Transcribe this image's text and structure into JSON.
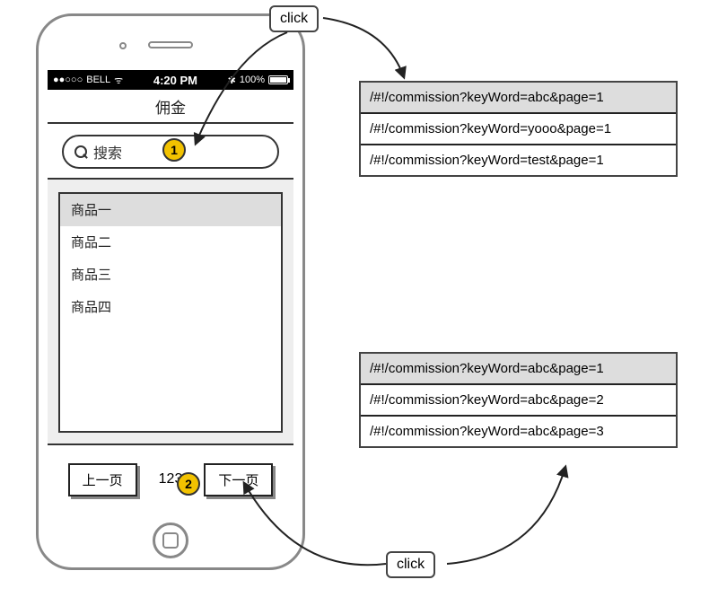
{
  "statusbar": {
    "carrier": "BELL",
    "signal": "●●○○○",
    "wifi": "ᯤ",
    "time": "4:20 PM",
    "bt": "✱",
    "battery_pct": "100%"
  },
  "header": {
    "title": "佣金"
  },
  "search": {
    "placeholder": "搜索"
  },
  "list": {
    "items": [
      "商品一",
      "商品二",
      "商品三",
      "商品四"
    ]
  },
  "pager": {
    "prev": "上一页",
    "nums": "123",
    "next": "下一页"
  },
  "callouts": {
    "top": {
      "label": "click",
      "rows": [
        "/#!/commission?keyWord=abc&page=1",
        "/#!/commission?keyWord=yooo&page=1",
        "/#!/commission?keyWord=test&page=1"
      ]
    },
    "bottom": {
      "label": "click",
      "rows": [
        "/#!/commission?keyWord=abc&page=1",
        "/#!/commission?keyWord=abc&page=2",
        "/#!/commission?keyWord=abc&page=3"
      ]
    }
  },
  "badges": {
    "one": "1",
    "two": "2"
  }
}
